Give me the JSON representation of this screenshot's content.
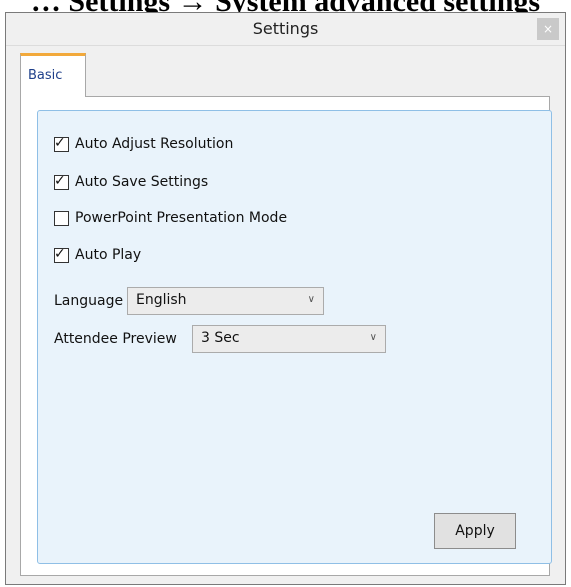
{
  "doc_caption": "… Settings → System advanced settings",
  "window": {
    "title": "Settings",
    "close_glyph": "×"
  },
  "tabs": [
    {
      "label": "Basic",
      "active": true
    }
  ],
  "options": [
    {
      "label": "Auto Adjust Resolution",
      "checked": true
    },
    {
      "label": "Auto Save Settings",
      "checked": true
    },
    {
      "label": "PowerPoint Presentation Mode",
      "checked": false
    },
    {
      "label": "Auto Play",
      "checked": true
    }
  ],
  "check_glyph": "✓",
  "language": {
    "label": "Language",
    "value": "English",
    "chevron": "∨"
  },
  "attendee_preview": {
    "label": "Attendee Preview",
    "value": "3 Sec",
    "chevron": "∨"
  },
  "apply_button": {
    "label": "Apply"
  },
  "colors": {
    "tab_accent": "#f2a93b",
    "group_bg": "#e9f3fb",
    "group_border": "#8fbfe6"
  }
}
